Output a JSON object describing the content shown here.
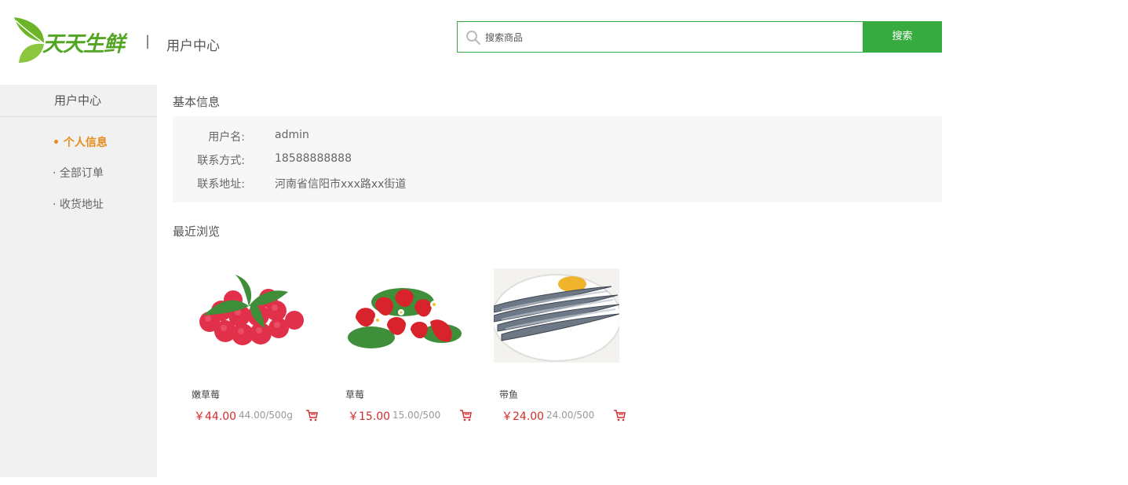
{
  "header": {
    "logo_text": "天天生鲜",
    "divider": "|",
    "page_title": "用户中心"
  },
  "search": {
    "placeholder": "搜索商品",
    "button_label": "搜索"
  },
  "sidebar": {
    "title": "用户中心",
    "items": [
      {
        "label": "• 个人信息",
        "active": true
      },
      {
        "label": "· 全部订单",
        "active": false
      },
      {
        "label": "· 收货地址",
        "active": false
      }
    ]
  },
  "basic_info": {
    "title": "基本信息",
    "rows": [
      {
        "label": "用户名:",
        "value": "admin"
      },
      {
        "label": "联系方式:",
        "value": "18588888888"
      },
      {
        "label": "联系地址:",
        "value": "河南省信阳市xxx路xx街道"
      }
    ]
  },
  "recent": {
    "title": "最近浏览",
    "goods": [
      {
        "name": "嫩草莓",
        "price": "￥44.00",
        "unit": "44.00/500g",
        "image": "raspberry-image"
      },
      {
        "name": "草莓",
        "price": "￥15.00",
        "unit": "15.00/500",
        "image": "strawberry-image"
      },
      {
        "name": "带鱼",
        "price": "￥24.00",
        "unit": "24.00/500",
        "image": "fish-image"
      }
    ]
  },
  "colors": {
    "brand_green": "#37ab40",
    "active_orange": "#e78c1c",
    "price_red": "#d32b2b",
    "sidebar_bg": "#f1f1f1"
  }
}
